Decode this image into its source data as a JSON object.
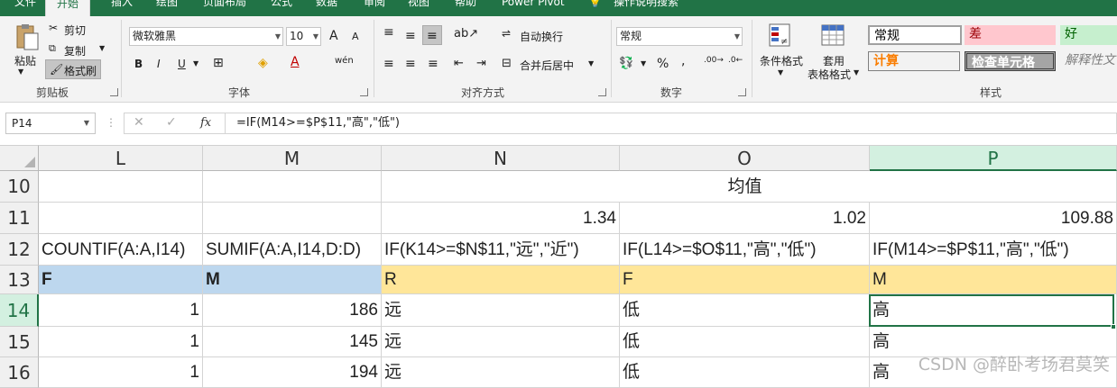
{
  "tabs": [
    "文件",
    "开始",
    "插入",
    "绘图",
    "页面布局",
    "公式",
    "数据",
    "审阅",
    "视图",
    "帮助",
    "Power Pivot",
    "操作说明搜索"
  ],
  "ribbon": {
    "clipboard": {
      "label": "剪贴板",
      "paste": "粘贴",
      "cut": "剪切",
      "copy": "复制",
      "format_painter": "格式刷"
    },
    "font": {
      "label": "字体",
      "name": "微软雅黑",
      "size": "10",
      "bold": "B",
      "italic": "I",
      "underline": "U",
      "grow": "A",
      "shrink": "A",
      "phonetic": "wén"
    },
    "alignment": {
      "label": "对齐方式",
      "wrap": "自动换行",
      "merge": "合并后居中"
    },
    "number": {
      "label": "数字",
      "format": "常规",
      "percent": "%",
      "comma": ","
    },
    "styles_group": {
      "label": "样式",
      "conditional": "条件格式",
      "table": "套用",
      "table2": "表格格式",
      "cells": [
        {
          "text": "常规",
          "bg": "#ffffff",
          "fg": "#000000"
        },
        {
          "text": "差",
          "bg": "#ffc7ce",
          "fg": "#9c0006"
        },
        {
          "text": "好",
          "bg": "#c6efce",
          "fg": "#006100"
        },
        {
          "text": "计算",
          "bg": "#f2f2f2",
          "fg": "#fa7d00"
        },
        {
          "text": "检查单元格",
          "bg": "#a5a5a5",
          "fg": "#ffffff"
        },
        {
          "text": "解释性文",
          "bg": "#ffffff",
          "fg": "#7f7f7f"
        }
      ]
    }
  },
  "formula_bar": {
    "name_box": "P14",
    "cancel": "✕",
    "enter": "✓",
    "fx": "fx",
    "formula": "=IF(M14>=$P$11,\"高\",\"低\")"
  },
  "columns": [
    "L",
    "M",
    "N",
    "O",
    "P"
  ],
  "rows": [
    {
      "num": "10",
      "cells": [
        "",
        "",
        "",
        "均值",
        ""
      ]
    },
    {
      "num": "11",
      "cells": [
        "",
        "",
        "1.34",
        "1.02",
        "109.88"
      ]
    },
    {
      "num": "12",
      "cells": [
        "COUNTIF(A:A,I14)",
        "SUMIF(A:A,I14,D:D)",
        "IF(K14>=$N$11,\"远\",\"近\")",
        "IF(L14>=$O$11,\"高\",\"低\")",
        "IF(M14>=$P$11,\"高\",\"低\")"
      ]
    },
    {
      "num": "13",
      "cells": [
        "F",
        "M",
        "R",
        "F",
        "M"
      ]
    },
    {
      "num": "14",
      "cells": [
        "1",
        "186",
        "远",
        "低",
        "高"
      ]
    },
    {
      "num": "15",
      "cells": [
        "1",
        "145",
        "远",
        "低",
        "高"
      ]
    },
    {
      "num": "16",
      "cells": [
        "1",
        "194",
        "远",
        "低",
        "高"
      ]
    }
  ],
  "watermark": "CSDN @醉卧考场君莫笑",
  "colors": {
    "excel_green": "#217346",
    "header_blue": "#bdd7ee",
    "header_yellow": "#ffe699"
  }
}
